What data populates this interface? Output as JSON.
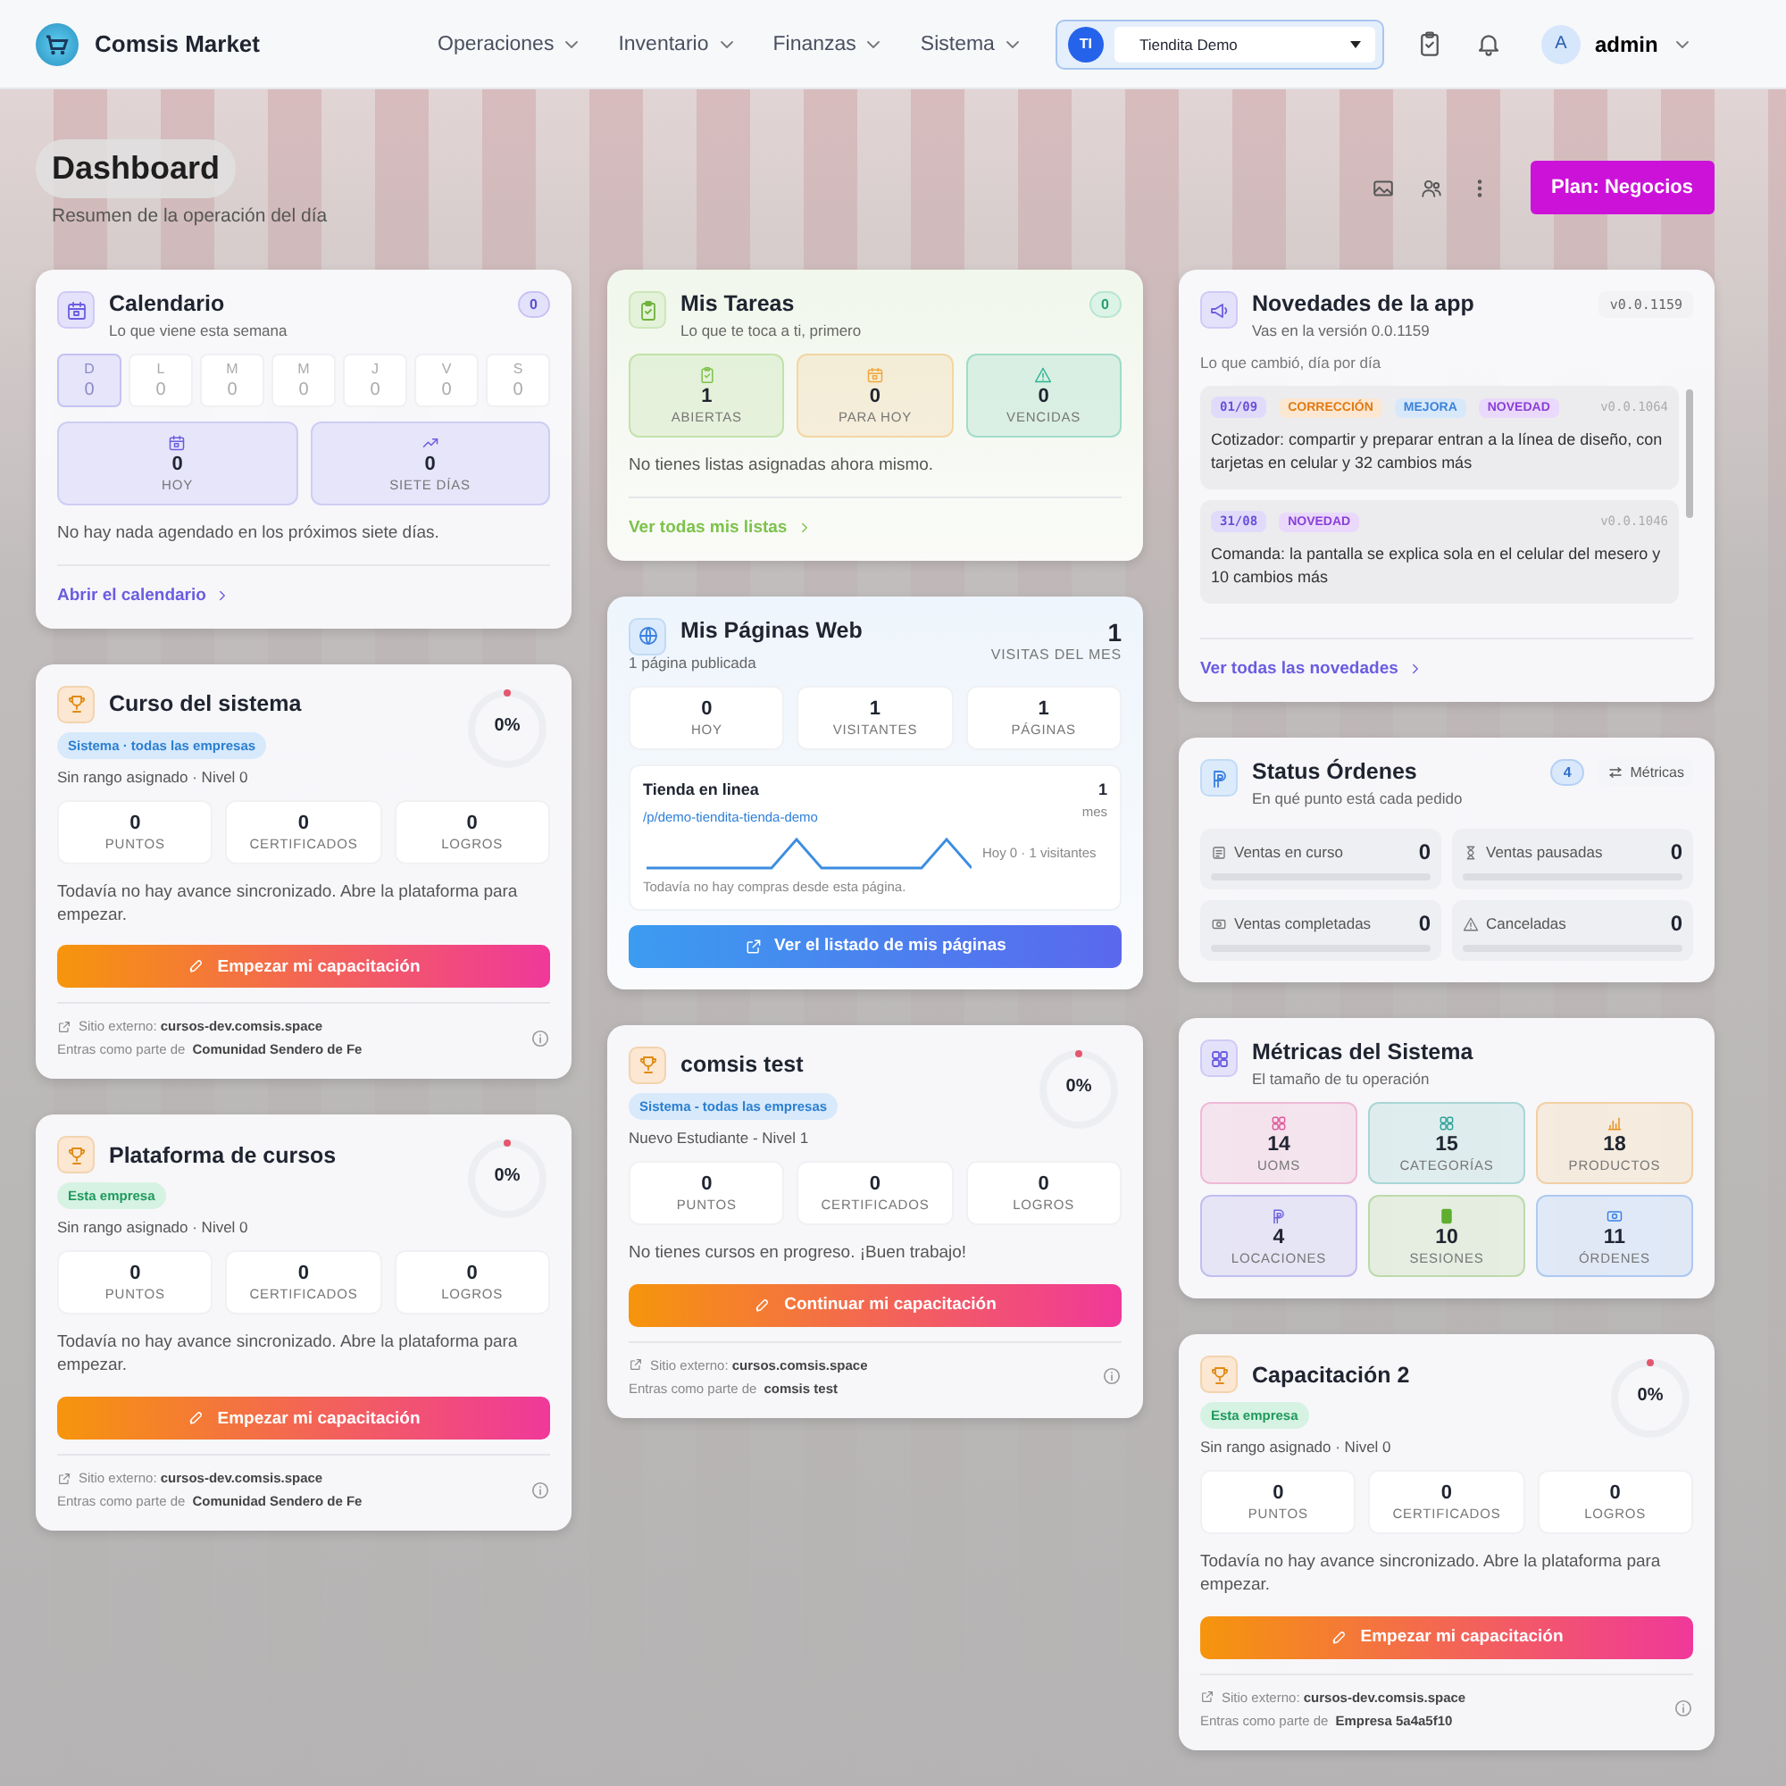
{
  "header": {
    "brand": "Comsis Market",
    "nav": [
      {
        "label": "Operaciones"
      },
      {
        "label": "Inventario"
      },
      {
        "label": "Finanzas"
      },
      {
        "label": "Sistema"
      }
    ],
    "tenant": {
      "initials": "TI",
      "name": "Tiendita Demo"
    },
    "user": {
      "initial": "A",
      "name": "admin"
    }
  },
  "page": {
    "title": "Dashboard",
    "subtitle": "Resumen de la operación del día",
    "plan_button": "Plan: Negocios"
  },
  "columns": [
    [
      {
        "kind": "calendar",
        "title": "Calendario",
        "subtitle": "Lo que viene esta semana",
        "badge": "0",
        "days": [
          {
            "letter": "D",
            "count": "0",
            "selected": true
          },
          {
            "letter": "L",
            "count": "0",
            "selected": false
          },
          {
            "letter": "M",
            "count": "0",
            "selected": false
          },
          {
            "letter": "M",
            "count": "0",
            "selected": false
          },
          {
            "letter": "J",
            "count": "0",
            "selected": false
          },
          {
            "letter": "V",
            "count": "0",
            "selected": false
          },
          {
            "letter": "S",
            "count": "0",
            "selected": false
          }
        ],
        "stats": [
          {
            "value": "0",
            "label": "HOY"
          },
          {
            "value": "0",
            "label": "SIETE DÍAS"
          }
        ],
        "message": "No hay nada agendado en los próximos siete días.",
        "link": "Abrir el calendario"
      },
      {
        "kind": "course",
        "title": "Curso del sistema",
        "scope": {
          "label": "Sistema · todas las empresas",
          "kind": "system"
        },
        "rank": "Sin rango asignado · Nivel 0",
        "percent": "0%",
        "stats": [
          {
            "value": "0",
            "label": "PUNTOS"
          },
          {
            "value": "0",
            "label": "CERTIFICADOS"
          },
          {
            "value": "0",
            "label": "LOGROS"
          }
        ],
        "message": "Todavía no hay avance sincronizado. Abre la plataforma para empezar.",
        "button": "Empezar mi capacitación",
        "site": "Sitio externo: **cursos-dev.comsis.space**",
        "member": "Entras como parte de **Comunidad Sendero de Fe**"
      },
      {
        "kind": "course",
        "title": "Plataforma de cursos",
        "scope": {
          "label": "Esta empresa",
          "kind": "company"
        },
        "rank": "Sin rango asignado · Nivel 0",
        "percent": "0%",
        "stats": [
          {
            "value": "0",
            "label": "PUNTOS"
          },
          {
            "value": "0",
            "label": "CERTIFICADOS"
          },
          {
            "value": "0",
            "label": "LOGROS"
          }
        ],
        "message": "Todavía no hay avance sincronizado. Abre la plataforma para empezar.",
        "button": "Empezar mi capacitación",
        "site": "Sitio externo: **cursos-dev.comsis.space**",
        "member": "Entras como parte de **Comunidad Sendero de Fe**"
      }
    ],
    [
      {
        "kind": "tasks",
        "title": "Mis Tareas",
        "subtitle": "Lo que te toca a ti, primero",
        "badge": "0",
        "stats": [
          {
            "value": "1",
            "label": "ABIERTAS",
            "color": "#7cc24a"
          },
          {
            "value": "0",
            "label": "PARA HOY",
            "color": "#f0a83a"
          },
          {
            "value": "0",
            "label": "VENCIDAS",
            "color": "#2bb592"
          }
        ],
        "message": "No tienes listas asignadas ahora mismo.",
        "link": "Ver todas mis listas"
      },
      {
        "kind": "web",
        "title": "Mis Páginas Web",
        "subtitle": "1 página publicada",
        "total": "1",
        "total_label": "VISITAS DEL MES",
        "stats": [
          {
            "value": "0",
            "label": "HOY"
          },
          {
            "value": "1",
            "label": "VISITANTES"
          },
          {
            "value": "1",
            "label": "PÁGINAS"
          }
        ],
        "site": {
          "name": "Tienda en linea",
          "path": "/p/demo-tiendita-tienda-demo",
          "count": "1",
          "count_label": "mes",
          "reading": "Hoy 0 · 1 visitantes",
          "message": "Todavía no hay compras desde esta página."
        },
        "button": "Ver el listado de mis páginas"
      },
      {
        "kind": "course",
        "title": "comsis test",
        "scope": {
          "label": "Sistema - todas las empresas",
          "kind": "system"
        },
        "rank": "Nuevo Estudiante - Nivel 1",
        "percent": "0%",
        "stats": [
          {
            "value": "0",
            "label": "PUNTOS"
          },
          {
            "value": "0",
            "label": "CERTIFICADOS"
          },
          {
            "value": "0",
            "label": "LOGROS"
          }
        ],
        "message": "No tienes cursos en progreso. ¡Buen trabajo!",
        "button": "Continuar mi capacitación",
        "site": "Sitio externo: **cursos.comsis.space**",
        "member": "Entras como parte de **comsis test**"
      }
    ],
    [
      {
        "kind": "news",
        "title": "Novedades de la app",
        "subtitle": "Vas en la versión 0.0.1159",
        "version": "v0.0.1159",
        "section_label": "Lo que cambió, día por día",
        "items": [
          {
            "date": "01/09",
            "tags": [
              {
                "label": "CORRECCIÓN",
                "kind": "fix"
              },
              {
                "label": "MEJORA",
                "kind": "improvement"
              },
              {
                "label": "NOVEDAD",
                "kind": "new"
              }
            ],
            "version": "v0.0.1064",
            "text": "Cotizador: compartir y preparar entran a la línea de diseño, con tarjetas en celular y 32 cambios más"
          },
          {
            "date": "31/08",
            "tags": [
              {
                "label": "NOVEDAD",
                "kind": "new"
              }
            ],
            "version": "v0.0.1046",
            "text": "Comanda: la pantalla se explica sola en el celular del mesero y 10 cambios más"
          }
        ],
        "link": "Ver todas las novedades"
      },
      {
        "kind": "orders",
        "title": "Status Órdenes",
        "subtitle": "En qué punto está cada pedido",
        "badge": "4",
        "metrics_button": "Métricas",
        "statuses": [
          {
            "label": "Ventas en curso",
            "value": "0",
            "level": 0
          },
          {
            "label": "Ventas pausadas",
            "value": "0",
            "level": 0
          },
          {
            "label": "Ventas completadas",
            "value": "0",
            "level": 0
          },
          {
            "label": "Canceladas",
            "value": "0",
            "level": 0
          }
        ]
      },
      {
        "kind": "metrics",
        "title": "Métricas del Sistema",
        "subtitle": "El tamaño de tu operación",
        "tiles": [
          {
            "value": "14",
            "label": "UOMS",
            "color": "#e0599a"
          },
          {
            "value": "15",
            "label": "CATEGORÍAS",
            "color": "#2fa39a"
          },
          {
            "value": "18",
            "label": "PRODUCTOS",
            "color": "#e8921e"
          },
          {
            "value": "4",
            "label": "LOCACIONES",
            "color": "#6b62e0"
          },
          {
            "value": "10",
            "label": "SESIONES",
            "color": "#5fae2f"
          },
          {
            "value": "11",
            "label": "ÓRDENES",
            "color": "#3b82e6"
          }
        ]
      },
      {
        "kind": "course",
        "title": "Capacitación 2",
        "scope": {
          "label": "Esta empresa",
          "kind": "company"
        },
        "rank": "Sin rango asignado · Nivel 0",
        "percent": "0%",
        "stats": [
          {
            "value": "0",
            "label": "PUNTOS"
          },
          {
            "value": "0",
            "label": "CERTIFICADOS"
          },
          {
            "value": "0",
            "label": "LOGROS"
          }
        ],
        "message": "Todavía no hay avance sincronizado. Abre la plataforma para empezar.",
        "button": "Empezar mi capacitación",
        "site": "Sitio externo: **cursos-dev.comsis.space**",
        "member": "Entras como parte de **Empresa 5a4a5f10**"
      }
    ]
  ]
}
